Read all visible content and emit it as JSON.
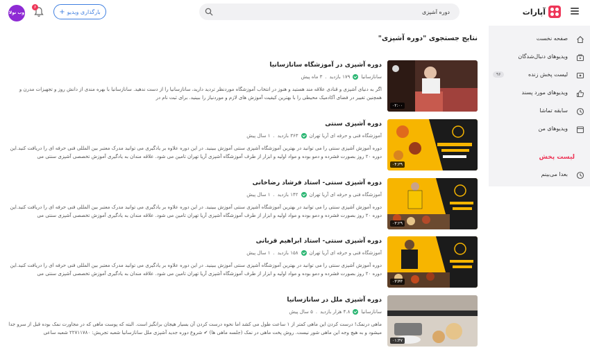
{
  "header": {
    "logo_text": "آپارات",
    "search_value": "دوره آشپزی",
    "upload_label": "بارگذاری ویدیو",
    "notification_count": "۶",
    "avatar_label": "وب نولا"
  },
  "sidebar": {
    "items": [
      {
        "label": "صفحه نخست",
        "icon": "home-icon"
      },
      {
        "label": "ویدیوهای دنبال‌شدگان",
        "icon": "subscriptions-icon"
      },
      {
        "label": "لیست پخش زنده",
        "icon": "live-icon",
        "count": "۹۶"
      },
      {
        "label": "ویدیوهای مورد پسند",
        "icon": "like-icon"
      },
      {
        "label": "سابقه تماشا",
        "icon": "history-icon"
      },
      {
        "label": "ویدیوهای من",
        "icon": "my-videos-icon"
      }
    ],
    "playlist_heading": "لیست پخش",
    "watch_later": {
      "label": "بعدا می‌بینم",
      "icon": "clock-icon"
    }
  },
  "results": {
    "title": "نتایج جستجوی \"دوره آشپزی\"",
    "items": [
      {
        "title": "دوره آشپزی در آموزشگاه سانازسانیا",
        "channel": "سانازسانیا",
        "views": "۱۷۹ بازدید",
        "age": "۳ ماه پیش",
        "duration": "۰۲:۰۰",
        "desc": "اگر به دنیای آشپزی و قنادی علاقه مند هستید و هنوز در انتخاب آموزشگاه موردنظر تردید دارید، سانازسانیا را از دست ندهید. سانازسانیا با بهره مندی از دانش روز و تجهیزات مدرن و همچنین تغییر در فضای آکادمیک محیطی را با بهترین کیفیت آموزش های لازم و موردنیاز را ببینید. برای ثبت نام در"
      },
      {
        "title": "دوره آشپزی سنتی",
        "channel": "آموزشگاه فنی و حرفه ای آریا تهران",
        "views": "۳۶۳ بازدید",
        "age": "۱ سال پیش",
        "duration": "۰۴:۳۹",
        "desc": "دوره آموزش آشپزی سنتی را می توانید در بهترین آموزشگاه آشپزی سنتی آموزش ببینید. در این دوره علاوه بر یادگیری می توانید مدرک معتبر بین المللی فنی حرفه ای را دریافت کنید.این دوره ۲۰ روز بصورت فشرده و دمو بوده و مواد اولیه و ابزار از طرف آموزشگاه آشپزی آریا تهران تامین می شود. علاقه مندان به یادگیری آموزش تخصصی آشپزی سنتی می"
      },
      {
        "title": "دوره آشپزی سنتی- استاد فرشاد رضاخانی",
        "channel": "آموزشگاه فنی و حرفه ای آریا تهران",
        "views": "۱۴۲ بازدید",
        "age": "۱ سال پیش",
        "duration": "۰۳:۲۹",
        "desc": "دوره آموزش آشپزی سنتی را می توانید در بهترین آموزشگاه آشپزی سنتی آموزش ببینید. در این دوره علاوه بر یادگیری می توانید مدرک معتبر بین المللی فنی حرفه ای را دریافت کنید.این دوره ۲۰ روز بصورت فشرده و دمو بوده و مواد اولیه و ابزار از طرف آموزشگاه آشپزی آریا تهران تامین می شود. علاقه مندان به یادگیری آموزش تخصصی آشپزی سنتی می"
      },
      {
        "title": "دوره آشپزی سنتی- استاد ابراهیم قربانی",
        "channel": "آموزشگاه فنی و حرفه ای آریا تهران",
        "views": "۱۵۸ بازدید",
        "age": "۱ سال پیش",
        "duration": "۰۳:۴۳",
        "desc": "دوره آموزش آشپزی سنتی را می توانید در بهترین آموزشگاه آشپزی سنتی آموزش ببینید. در این دوره علاوه بر یادگیری می توانید مدرک معتبر بین المللی فنی حرفه ای را دریافت کنید.این دوره ۲۰ روز بصورت فشرده و دمو بوده و مواد اولیه و ابزار از طرف آموزشگاه آشپزی آریا تهران تامین می شود. علاقه مندان به یادگیری آموزش تخصصی آشپزی سنتی می"
      },
      {
        "title": "دوره آشپزی ملل در سانازسانیا",
        "channel": "سانازسانیا",
        "views": "۴.۸ هزار بازدید",
        "age": "۵ سال پیش",
        "duration": "۰۱:۴۷",
        "desc": "ماهی درنمک! درست کردن این ماهی کمتر از ۱ ساعت طول می کشد اما نحوه درست کردن آن بسیار هیجان برانگیز است. البته که پوست ماهی که در مجاورت نمک بوده قبل از سرو جدا میشود و به هیچ وجه این ماهی شور نیست. روش پخت ماهی در نمک (جلسه ماهی ها) ✔ شروع دوره جدید آشپزی ملل سانازسانیا شعبه تجریش: ۲۲۷۱۱۷۸۰ شعبه ساعی"
      }
    ]
  },
  "colors": {
    "brand": "#ee3658",
    "accent": "#3f7fe0",
    "verified": "#2bb673",
    "avatar": "#8e2bd4",
    "sidebar_bg": "#f3f3f5",
    "thumb_yellow": "#f7b500"
  }
}
